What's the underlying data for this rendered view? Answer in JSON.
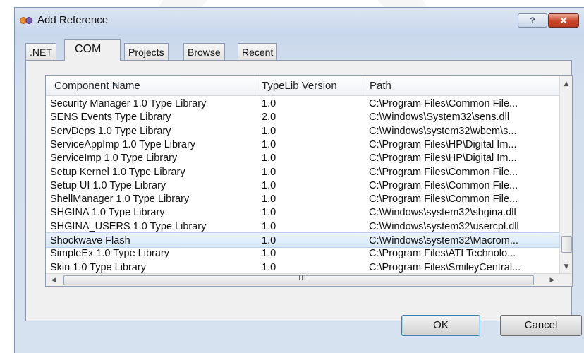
{
  "dialog": {
    "title": "Add Reference",
    "help_label": "?",
    "close_label": "✕"
  },
  "tabs": [
    {
      "label": ".NET",
      "active": false
    },
    {
      "label": "COM",
      "active": true
    },
    {
      "label": "Projects",
      "active": false
    },
    {
      "label": "Browse",
      "active": false
    },
    {
      "label": "Recent",
      "active": false
    }
  ],
  "table": {
    "columns": [
      "Component Name",
      "TypeLib Version",
      "Path"
    ],
    "rows": [
      {
        "name": "Security Manager 1.0 Type Library",
        "version": "1.0",
        "path": "C:\\Program Files\\Common File..."
      },
      {
        "name": "SENS Events Type Library",
        "version": "2.0",
        "path": "C:\\Windows\\System32\\sens.dll"
      },
      {
        "name": "ServDeps 1.0 Type Library",
        "version": "1.0",
        "path": "C:\\Windows\\system32\\wbem\\s..."
      },
      {
        "name": "ServiceAppImp 1.0 Type Library",
        "version": "1.0",
        "path": "C:\\Program Files\\HP\\Digital Im..."
      },
      {
        "name": "ServiceImp 1.0 Type Library",
        "version": "1.0",
        "path": "C:\\Program Files\\HP\\Digital Im..."
      },
      {
        "name": "Setup Kernel 1.0 Type Library",
        "version": "1.0",
        "path": "C:\\Program Files\\Common File..."
      },
      {
        "name": "Setup UI 1.0 Type Library",
        "version": "1.0",
        "path": "C:\\Program Files\\Common File..."
      },
      {
        "name": "ShellManager 1.0 Type Library",
        "version": "1.0",
        "path": "C:\\Program Files\\Common File..."
      },
      {
        "name": "SHGINA 1.0 Type Library",
        "version": "1.0",
        "path": "C:\\Windows\\system32\\shgina.dll"
      },
      {
        "name": "SHGINA_USERS 1.0 Type Library",
        "version": "1.0",
        "path": "C:\\Windows\\system32\\usercpl.dll"
      },
      {
        "name": "Shockwave Flash",
        "version": "1.0",
        "path": "C:\\Windows\\system32\\Macrom...",
        "selected": true
      },
      {
        "name": "SimpleEx 1.0 Type Library",
        "version": "1.0",
        "path": "C:\\Program Files\\ATI Technolo..."
      },
      {
        "name": "Skin 1.0 Type Library",
        "version": "1.0",
        "path": "C:\\Program Files\\SmileyCentral..."
      }
    ],
    "selected_index": 10
  },
  "scrollbar": {
    "grip": "III"
  },
  "buttons": {
    "ok": "OK",
    "cancel": "Cancel"
  },
  "colors": {
    "selection": "#d7e8f9",
    "close_button": "#c9452a",
    "ok_border": "#3c7fb1"
  }
}
